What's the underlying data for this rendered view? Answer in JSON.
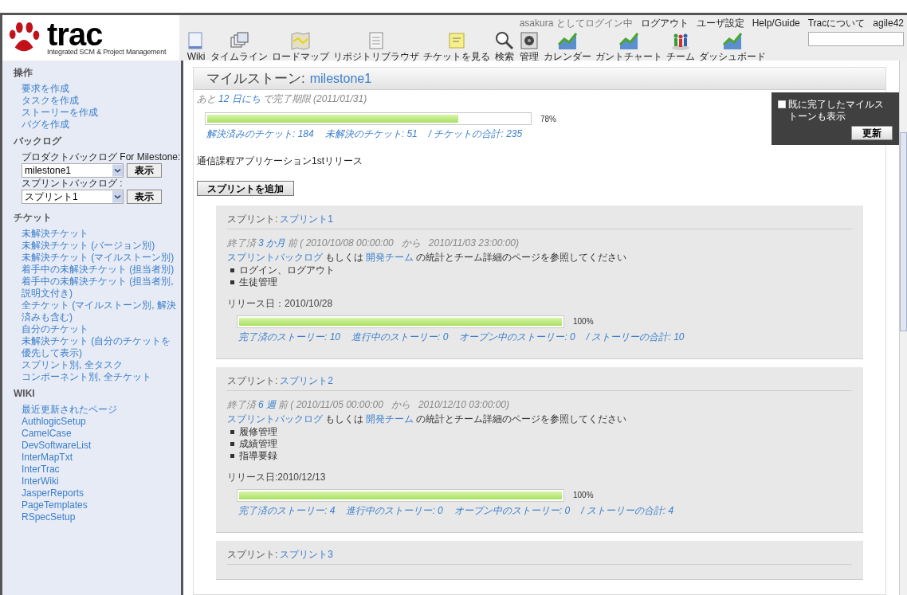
{
  "logo": {
    "wordmark": "trac",
    "tagline": "Integrated SCM & Project Management"
  },
  "nav": [
    {
      "label": "Wiki"
    },
    {
      "label": "タイムライン"
    },
    {
      "label": "ロードマップ"
    },
    {
      "label": "リポジトリブラウザ"
    },
    {
      "label": "チケットを見る"
    },
    {
      "label": "検索"
    },
    {
      "label": "管理"
    },
    {
      "label": "カレンダー"
    },
    {
      "label": "ガントチャート"
    },
    {
      "label": "チーム"
    },
    {
      "label": "ダッシュボード"
    }
  ],
  "meta_nav": {
    "user": "asakura",
    "login_text": "としてログイン中",
    "links": [
      "ログアウト",
      "ユーザ設定",
      "Help/Guide",
      "Tracについて",
      "agile42"
    ]
  },
  "sidebar": [
    {
      "kind": "links",
      "heading": "操作",
      "items": [
        "要求を作成",
        "タスクを作成",
        "ストーリーを作成",
        "バグを作成"
      ]
    },
    {
      "kind": "backlog",
      "heading": "バックログ",
      "selects": [
        {
          "label": "プロダクトバックログ For Milestone:",
          "value": "milestone1",
          "button": "表示"
        },
        {
          "label": "スプリントバックログ :",
          "value": "スプリント1",
          "button": "表示"
        }
      ]
    },
    {
      "kind": "links",
      "heading": "チケット",
      "items": [
        "未解決チケット",
        "未解決チケット (バージョン別)",
        "未解決チケット (マイルストーン別)",
        "着手中の未解決チケット (担当者別)",
        "着手中の未解決チケット (担当者別, 説明文付き)",
        "全チケット (マイルストーン別, 解決済みも含む)",
        "自分のチケット",
        "未解決チケット (自分のチケットを優先して表示)",
        "スプリント別, 全タスク",
        "コンポーネント別, 全チケット"
      ]
    },
    {
      "kind": "links",
      "heading": "WIKI",
      "items": [
        "最近更新されたページ",
        "AuthlogicSetup",
        "CamelCase",
        "DevSoftwareList",
        "InterMapTxt",
        "InterTrac",
        "InterWiki",
        "JasperReports",
        "PageTemplates",
        "RSpecSetup"
      ]
    }
  ],
  "milestone": {
    "label": "マイルストーン:",
    "name": "milestone1",
    "due_prefix": "あと",
    "due_link": "12 日にち",
    "due_suffix": "で完了期限 (2011/01/31)",
    "level": 0.78,
    "percent": "78%",
    "stats": [
      {
        "label": "解決済みのチケット:",
        "value": "184"
      },
      {
        "label": "未解決のチケット:",
        "value": "51"
      },
      {
        "label": "/ チケットの合計:",
        "value": "235"
      }
    ],
    "description": "通信課程アプリケーション1stリリース",
    "add_button": "スプリントを追加"
  },
  "options": {
    "checkbox_label": "既に完了したマイルストーンも表示",
    "checked": false,
    "button": "更新"
  },
  "sprints": [
    {
      "label": "スプリント:",
      "name": "スプリント1",
      "status_prefix": "終了済",
      "status_link": "3 か月",
      "status_suffix": "前 ( 2010/10/08 00:00:00   から   2010/11/03 23:00:00)",
      "links": [
        "スプリントバックログ",
        "もしくは",
        "開発チーム",
        "の統計とチーム詳細のページを参照してください"
      ],
      "items": [
        "ログイン、ログアウト",
        "生徒管理"
      ],
      "release": "リリース日：2010/10/28",
      "level": 1,
      "percent": "100%",
      "stats": [
        {
          "label": "完了済のストーリー:",
          "value": "10"
        },
        {
          "label": "進行中のストーリー:",
          "value": "0"
        },
        {
          "label": "オープン中のストーリー:",
          "value": "0"
        },
        {
          "label": "/ ストーリーの合計:",
          "value": "10"
        }
      ]
    },
    {
      "label": "スプリント:",
      "name": "スプリント2",
      "status_prefix": "終了済",
      "status_link": "6 週",
      "status_suffix": "前 ( 2010/11/05 00:00:00   から   2010/12/10 03:00:00)",
      "links": [
        "スプリントバックログ",
        "もしくは",
        "開発チーム",
        "の統計とチーム詳細のページを参照してください"
      ],
      "items": [
        "履修管理",
        "成績管理",
        "指導要録"
      ],
      "release": "リリース日:2010/12/13",
      "level": 1,
      "percent": "100%",
      "stats": [
        {
          "label": "完了済のストーリー:",
          "value": "4"
        },
        {
          "label": "進行中のストーリー:",
          "value": "0"
        },
        {
          "label": "オープン中のストーリー:",
          "value": "0"
        },
        {
          "label": "/ ストーリーの合計:",
          "value": "4"
        }
      ]
    },
    {
      "label": "スプリント:",
      "name": "スプリント3"
    }
  ]
}
